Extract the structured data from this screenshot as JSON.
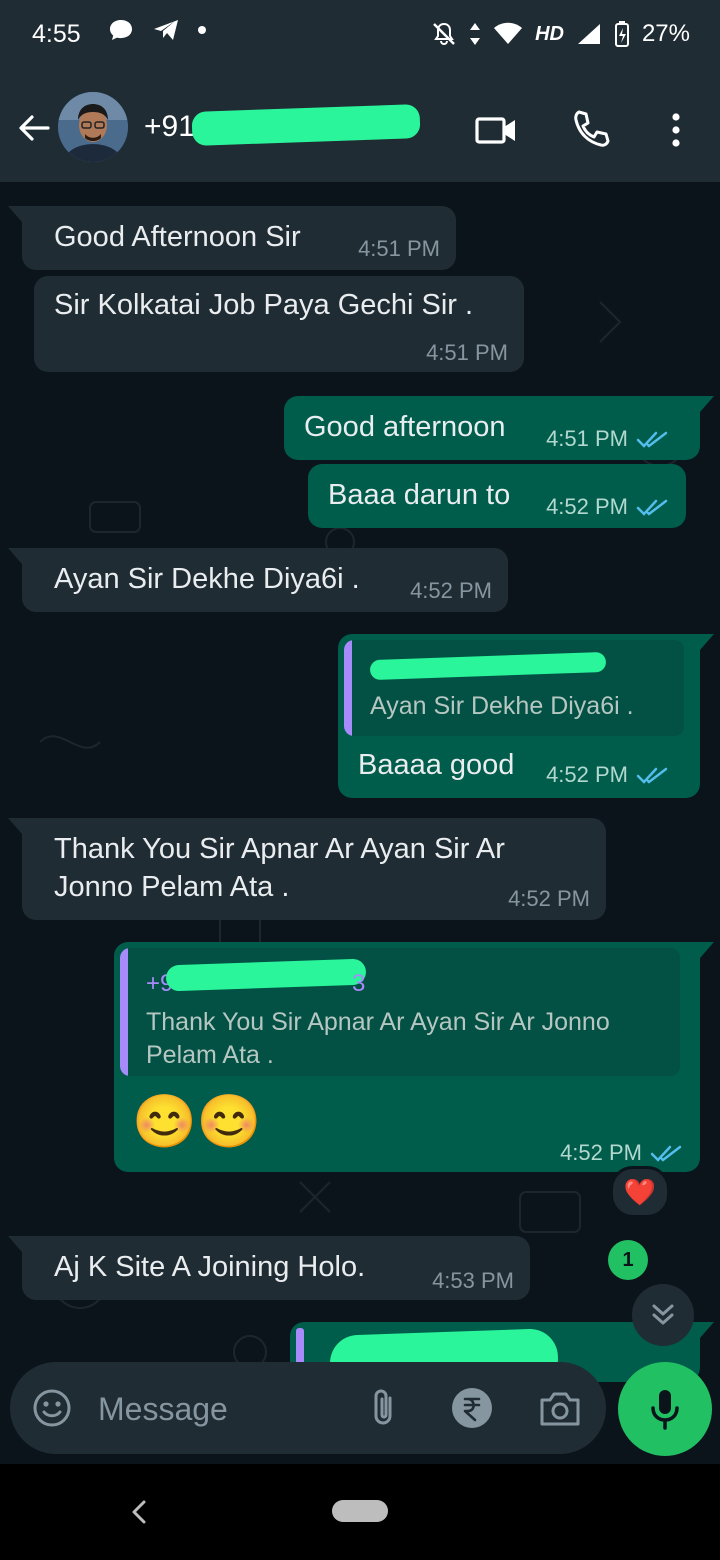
{
  "status_bar": {
    "time": "4:55",
    "network": "HD",
    "battery": "27%"
  },
  "header": {
    "contact_name": "+91",
    "contact_name_redacted": true
  },
  "messages": [
    {
      "direction": "in",
      "text": "Good Afternoon Sir",
      "time": "4:51 PM"
    },
    {
      "direction": "in",
      "text": "Sir Kolkatai Job Paya Gechi Sir .",
      "time": "4:51 PM"
    },
    {
      "direction": "out",
      "text": "Good afternoon",
      "time": "4:51 PM",
      "status": "read"
    },
    {
      "direction": "out",
      "text": "Baaa darun to",
      "time": "4:52 PM",
      "status": "read"
    },
    {
      "direction": "in",
      "text": "Ayan Sir Dekhe Diya6i .",
      "time": "4:52 PM"
    },
    {
      "direction": "out",
      "text": "Baaaa good",
      "time": "4:52 PM",
      "status": "read",
      "quote": {
        "text": "Ayan Sir Dekhe Diya6i ."
      }
    },
    {
      "direction": "in",
      "text_line1": "Thank You Sir Apnar Ar Ayan Sir Ar",
      "text_line2": "Jonno Pelam Ata .",
      "time": "4:52 PM"
    },
    {
      "direction": "out",
      "text": "😊😊",
      "time": "4:52 PM",
      "status": "read",
      "reaction": "❤️",
      "quote": {
        "sender": "+9",
        "sender_tail": "3",
        "text_line1": "Thank You Sir Apnar Ar Ayan Sir Ar Jonno",
        "text_line2": "Pelam Ata ."
      }
    },
    {
      "direction": "in",
      "text": "Aj K Site A Joining Holo.",
      "time": "4:53 PM"
    }
  ],
  "unread_count": "1",
  "composer": {
    "placeholder": "Message"
  },
  "icons": {
    "back": "arrow-left-icon",
    "video_call": "video-icon",
    "voice_call": "phone-icon",
    "menu": "more-vertical-icon",
    "emoji": "emoji-icon",
    "attach": "paperclip-icon",
    "payment": "rupee-icon",
    "camera": "camera-icon",
    "mic": "mic-icon"
  },
  "colors": {
    "accent": "#21c063",
    "outgoing_bubble": "#005c4b",
    "incoming_bubble": "#202c33",
    "read_ticks": "#53bdeb"
  }
}
